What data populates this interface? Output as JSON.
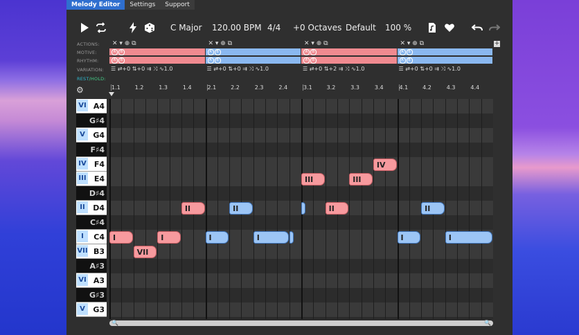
{
  "tabs": [
    {
      "label": "Melody Editor",
      "active": true
    },
    {
      "label": "Settings",
      "active": false
    },
    {
      "label": "Support",
      "active": false
    }
  ],
  "toolbar": {
    "key": "C Major",
    "tempo": "120.00 BPM",
    "time_signature": "4/4",
    "octaves": "+0 Octaves",
    "preset": "Default",
    "zoom": "100 %",
    "icons": [
      "play-icon",
      "loop-icon",
      "lightning-icon",
      "dice-icon",
      "file-music-icon",
      "heart-icon",
      "undo-icon",
      "redo-icon"
    ]
  },
  "track_labels": {
    "actions": "ACTIONS:",
    "motive": "MOTIVE:",
    "rhythm": "RHYTHM:",
    "variation": "VARIATION:",
    "rest": "REST",
    "hold": "/HOLD:"
  },
  "motive_chip_labels": [
    "A",
    "B"
  ],
  "variations": [
    {
      "shift": "+0",
      "step": "+0",
      "v": "1.0"
    },
    {
      "shift": "+0",
      "step": "+0",
      "v": "1.0"
    },
    {
      "shift": "+0",
      "step": "+2",
      "v": "1.0"
    },
    {
      "shift": "+0",
      "step": "+0",
      "v": "1.0"
    }
  ],
  "ruler": [
    "1.1",
    "1.2",
    "1.3",
    "1.4",
    "2.1",
    "2.2",
    "2.3",
    "2.4",
    "3.1",
    "3.2",
    "3.3",
    "3.4",
    "4.1",
    "4.2",
    "4.3",
    "4.4"
  ],
  "keys": [
    {
      "name": "A4",
      "roman": "VI",
      "black": false
    },
    {
      "name": "G♯4",
      "roman": "",
      "black": true
    },
    {
      "name": "G4",
      "roman": "V",
      "black": false
    },
    {
      "name": "F♯4",
      "roman": "",
      "black": true
    },
    {
      "name": "F4",
      "roman": "IV",
      "black": false
    },
    {
      "name": "E4",
      "roman": "III",
      "black": false
    },
    {
      "name": "D♯4",
      "roman": "",
      "black": true
    },
    {
      "name": "D4",
      "roman": "II",
      "black": false
    },
    {
      "name": "C♯4",
      "roman": "",
      "black": true
    },
    {
      "name": "C4",
      "roman": "I",
      "black": false
    },
    {
      "name": "B3",
      "roman": "VII",
      "black": false
    },
    {
      "name": "A♯3",
      "roman": "",
      "black": true
    },
    {
      "name": "A3",
      "roman": "VI",
      "black": false
    },
    {
      "name": "G♯3",
      "roman": "",
      "black": true
    },
    {
      "name": "G3",
      "roman": "V",
      "black": false
    }
  ],
  "notes": [
    {
      "label": "I",
      "pitch": "C4",
      "start": 0,
      "len": 2,
      "color": "red"
    },
    {
      "label": "VII",
      "pitch": "B3",
      "start": 2,
      "len": 2,
      "color": "red"
    },
    {
      "label": "I",
      "pitch": "C4",
      "start": 4,
      "len": 2,
      "color": "red"
    },
    {
      "label": "II",
      "pitch": "D4",
      "start": 6,
      "len": 2,
      "color": "red"
    },
    {
      "label": "I",
      "pitch": "C4",
      "start": 8,
      "len": 2,
      "color": "blue"
    },
    {
      "label": "II",
      "pitch": "D4",
      "start": 10,
      "len": 2,
      "color": "blue"
    },
    {
      "label": "I",
      "pitch": "C4",
      "start": 12,
      "len": 3,
      "color": "blue"
    },
    {
      "label": "",
      "pitch": "C4",
      "start": 15,
      "len": 0.4,
      "color": "blue"
    },
    {
      "label": "III",
      "pitch": "E4",
      "start": 16,
      "len": 2,
      "color": "red"
    },
    {
      "label": "",
      "pitch": "D4",
      "start": 16,
      "len": 0.4,
      "color": "blue"
    },
    {
      "label": "II",
      "pitch": "D4",
      "start": 18,
      "len": 2,
      "color": "red"
    },
    {
      "label": "III",
      "pitch": "E4",
      "start": 20,
      "len": 2,
      "color": "red"
    },
    {
      "label": "IV",
      "pitch": "F4",
      "start": 22,
      "len": 2,
      "color": "red"
    },
    {
      "label": "I",
      "pitch": "C4",
      "start": 24,
      "len": 2,
      "color": "blue"
    },
    {
      "label": "II",
      "pitch": "D4",
      "start": 26,
      "len": 2,
      "color": "blue"
    },
    {
      "label": "I",
      "pitch": "C4",
      "start": 28,
      "len": 4,
      "color": "blue"
    }
  ]
}
